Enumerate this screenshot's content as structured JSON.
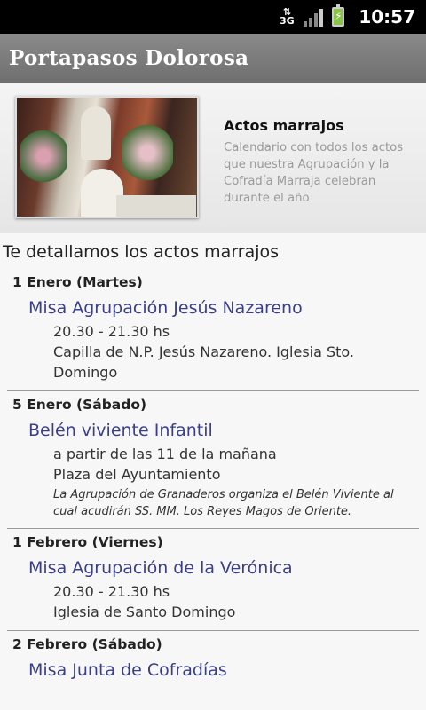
{
  "status_bar": {
    "network": "3G",
    "battery_icon": "battery-charging-icon",
    "time": "10:57"
  },
  "app": {
    "title": "Portapasos Dolorosa"
  },
  "header": {
    "title": "Actos marrajos",
    "description": "Calendario con todos los actos que nuestra Agrupación y la Cofradía Marraja celebran durante el año"
  },
  "intro": "Te detallamos los actos marrajos",
  "events": [
    {
      "date": "1 Enero (Martes)",
      "name": "Misa Agrupación Jesús Nazareno",
      "time": "20.30 - 21.30 hs",
      "place": "Capilla de N.P. Jesús Nazareno. Iglesia Sto. Domingo",
      "note": ""
    },
    {
      "date": "5 Enero (Sábado)",
      "name": "Belén viviente Infantil",
      "time": "a partir de las 11 de la mañana",
      "place": "Plaza del Ayuntamiento",
      "note": "La Agrupación de Granaderos organiza el Belén Viviente al cual acudirán SS. MM. Los Reyes Magos de Oriente."
    },
    {
      "date": "1 Febrero (Viernes)",
      "name": "Misa Agrupación de la Verónica",
      "time": "20.30 - 21.30 hs",
      "place": "Iglesia de Santo Domingo",
      "note": ""
    },
    {
      "date": "2 Febrero (Sábado)",
      "name": "Misa Junta de Cofradías",
      "time": "",
      "place": "",
      "note": ""
    }
  ]
}
